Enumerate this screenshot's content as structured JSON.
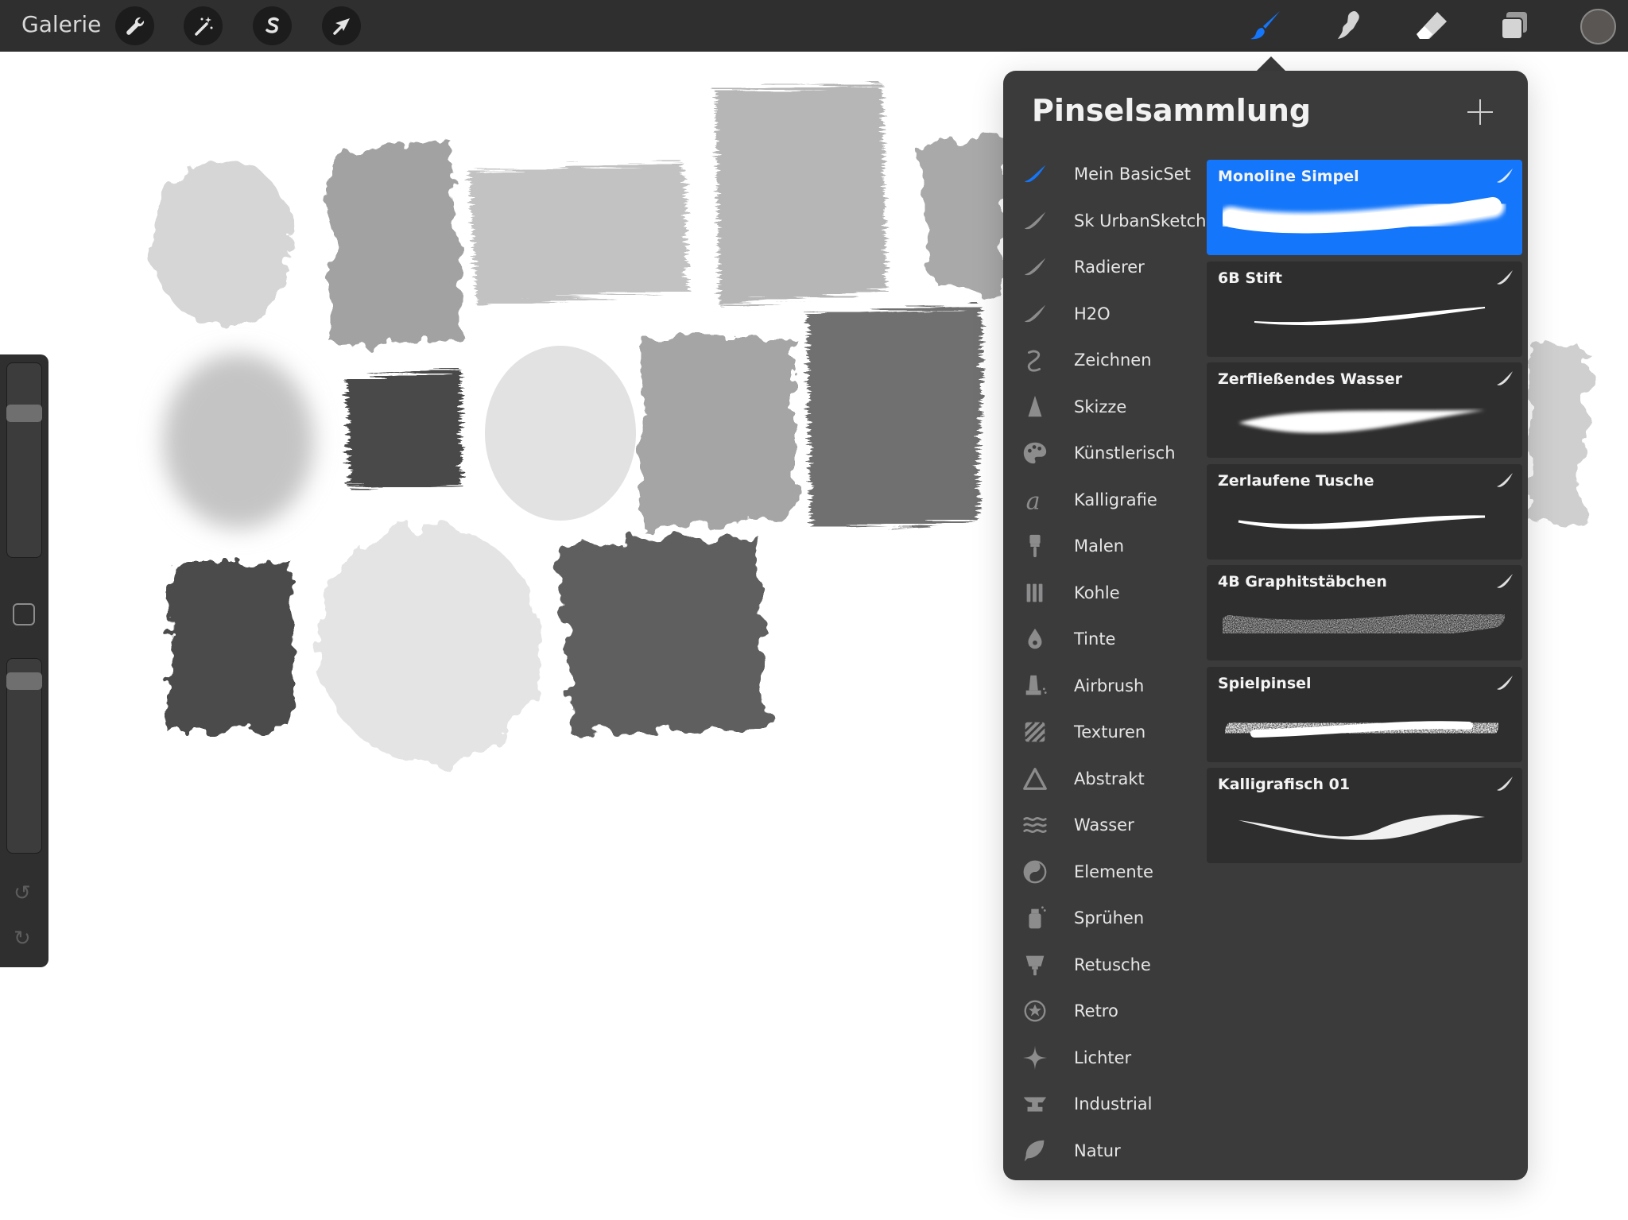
{
  "topbar": {
    "gallery_label": "Galerie",
    "left_tools": [
      "wrench-icon",
      "magic-wand-icon",
      "selection-s-icon",
      "transform-arrow-icon"
    ],
    "right_tools": [
      "brush-icon",
      "smudge-icon",
      "eraser-icon",
      "layers-icon"
    ],
    "active_tool": "brush-icon",
    "active_color": "#1476fa",
    "current_color": "#595654"
  },
  "panel": {
    "title": "Pinselsammlung",
    "brush_sets": [
      {
        "label": "Mein BasicSet",
        "icon": "stroke-icon",
        "active": true
      },
      {
        "label": "Sk UrbanSketch",
        "icon": "stroke-icon"
      },
      {
        "label": "Radierer",
        "icon": "stroke-icon"
      },
      {
        "label": "H2O",
        "icon": "stroke-icon"
      },
      {
        "label": "Zeichnen",
        "icon": "squiggle-icon"
      },
      {
        "label": "Skizze",
        "icon": "pencil-tip-icon"
      },
      {
        "label": "Künstlerisch",
        "icon": "palette-icon"
      },
      {
        "label": "Kalligrafie",
        "icon": "calligraphy-a-icon"
      },
      {
        "label": "Malen",
        "icon": "paintbrush-icon"
      },
      {
        "label": "Kohle",
        "icon": "charcoal-sticks-icon"
      },
      {
        "label": "Tinte",
        "icon": "ink-drop-icon"
      },
      {
        "label": "Airbrush",
        "icon": "airbrush-icon"
      },
      {
        "label": "Texturen",
        "icon": "texture-icon"
      },
      {
        "label": "Abstrakt",
        "icon": "triangle-icon"
      },
      {
        "label": "Wasser",
        "icon": "waves-icon"
      },
      {
        "label": "Elemente",
        "icon": "yin-yang-icon"
      },
      {
        "label": "Sprühen",
        "icon": "spray-can-icon"
      },
      {
        "label": "Retusche",
        "icon": "retouch-icon"
      },
      {
        "label": "Retro",
        "icon": "star-badge-icon"
      },
      {
        "label": "Lichter",
        "icon": "sparkle-icon"
      },
      {
        "label": "Industrial",
        "icon": "anvil-icon"
      },
      {
        "label": "Natur",
        "icon": "leaf-icon"
      }
    ],
    "brushes": [
      {
        "name": "Monoline Simpel",
        "selected": true
      },
      {
        "name": "6B Stift"
      },
      {
        "name": "Zerfließendes Wasser"
      },
      {
        "name": "Zerlaufene Tusche"
      },
      {
        "name": "4B Graphitstäbchen"
      },
      {
        "name": "Spielpinsel"
      },
      {
        "name": "Kalligrafisch 01"
      }
    ]
  },
  "sidebar": {
    "brush_size_level": 0.21,
    "opacity_level": 0.04
  }
}
